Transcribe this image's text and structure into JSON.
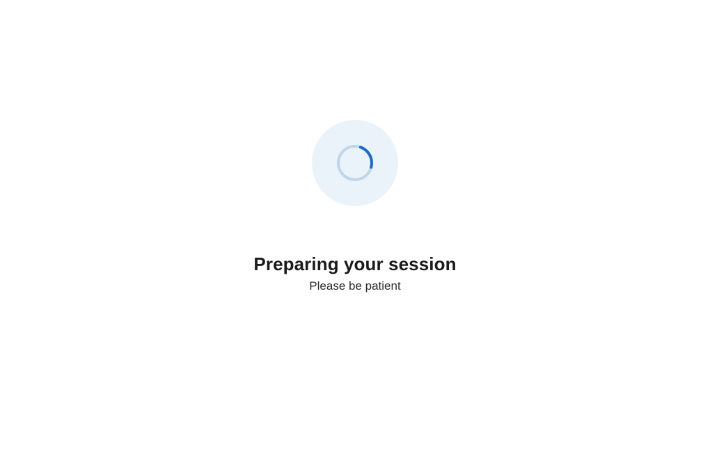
{
  "loading": {
    "heading": "Preparing your session",
    "subtext": "Please be patient"
  }
}
